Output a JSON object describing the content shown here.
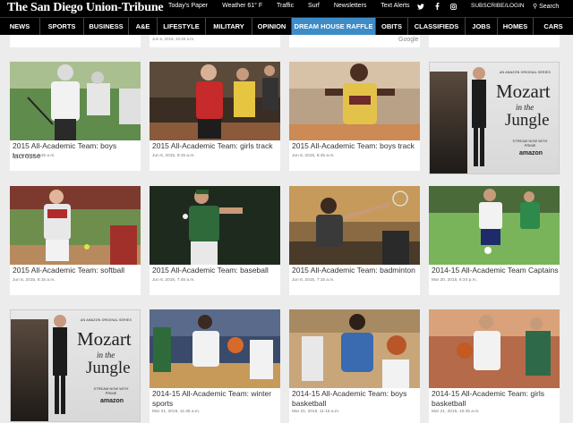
{
  "header": {
    "logo": "The San Diego Union-Tribune",
    "links": [
      "Today's Paper",
      "Weather 61° F",
      "Traffic",
      "Surf",
      "Newsletters",
      "Text Alerts"
    ],
    "social_icons": [
      "twitter-icon",
      "facebook-icon",
      "instagram-icon"
    ],
    "subscribe": "SUBSCRIBE/LOGIN",
    "search": "⚲ Search"
  },
  "nav": {
    "items": [
      "NEWS",
      "SPORTS",
      "BUSINESS",
      "A&E",
      "LIFESTYLE",
      "MILITARY",
      "OPINION",
      "DREAM HOUSE RAFFLE",
      "OBITS",
      "CLASSIFIEDS",
      "JOBS",
      "HOMES",
      "CARS"
    ],
    "active": "DREAM HOUSE RAFFLE"
  },
  "prev_row": {
    "date": "Jun 6, 2015, 10:45 a.m.",
    "google_label": "Google"
  },
  "cards": [
    {
      "title": "2015 All-Academic Team: boys lacrosse",
      "date": "Jun 6, 2015, 9:45 a.m."
    },
    {
      "title": "2015 All-Academic Team: girls track",
      "date": "Jun 6, 2015, 9:15 a.m."
    },
    {
      "title": "2015 All-Academic Team: boys track",
      "date": "Jun 6, 2015, 8:45 a.m."
    },
    {
      "title": "2015 All-Academic Team: softball",
      "date": "Jun 6, 2015, 8:15 a.m."
    },
    {
      "title": "2015 All-Academic Team: baseball",
      "date": "Jun 6, 2015, 7:45 a.m."
    },
    {
      "title": "2015 All-Academic Team: badminton",
      "date": "Jun 6, 2015, 7:15 a.m."
    },
    {
      "title": "2014-15 All-Academic Team Captains",
      "date": "Mar 20, 2015, 6:34 p.m."
    },
    {
      "title": "2014-15 All-Academic Team: winter sports",
      "date": "Mar 21, 2015, 11:45 a.m."
    },
    {
      "title": "2014-15 All-Academic Team: boys basketball",
      "date": "Mar 21, 2015, 11:15 a.m."
    },
    {
      "title": "2014-15 All-Academic Team: girls basketball",
      "date": "Mar 21, 2015, 10:45 a.m."
    }
  ],
  "ad": {
    "series": "AN AMAZON ORIGINAL SERIES",
    "title_line1": "Mozart",
    "title_line2": "in the",
    "title_line3": "Jungle",
    "stream": "STREAM NOW WITH PRIME",
    "brand": "amazon"
  },
  "colors": {
    "nav_bg": "#000000",
    "nav_active": "#3d8cc8",
    "page_bg": "#ececec"
  }
}
